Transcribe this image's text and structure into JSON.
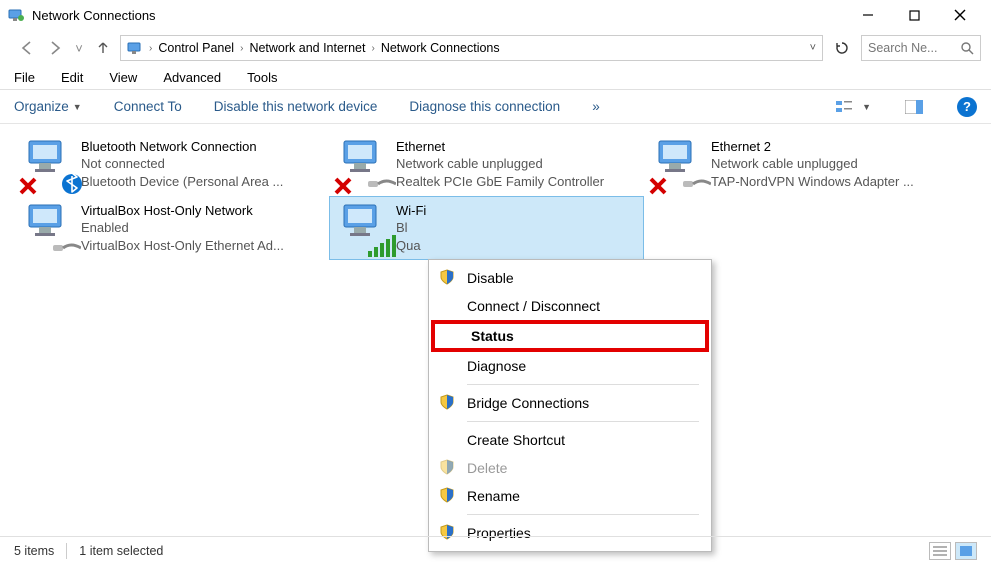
{
  "window": {
    "title": "Network Connections"
  },
  "address": {
    "crumbs": [
      "Control Panel",
      "Network and Internet",
      "Network Connections"
    ]
  },
  "search": {
    "placeholder": "Search Ne..."
  },
  "menubar": [
    "File",
    "Edit",
    "View",
    "Advanced",
    "Tools"
  ],
  "cmdbar": {
    "organize": "Organize",
    "connect": "Connect To",
    "disable": "Disable this network device",
    "diagnose": "Diagnose this connection",
    "more": "»"
  },
  "connections": [
    {
      "name": "Bluetooth Network Connection",
      "status": "Not connected",
      "device": "Bluetooth Device (Personal Area ...",
      "overlay": "bt-x"
    },
    {
      "name": "Ethernet",
      "status": "Network cable unplugged",
      "device": "Realtek PCIe GbE Family Controller",
      "overlay": "cable-x"
    },
    {
      "name": "Ethernet 2",
      "status": "Network cable unplugged",
      "device": "TAP-NordVPN Windows Adapter ...",
      "overlay": "cable-x"
    },
    {
      "name": "VirtualBox Host-Only Network",
      "status": "Enabled",
      "device": "VirtualBox Host-Only Ethernet Ad...",
      "overlay": "cable"
    },
    {
      "name": "Wi-Fi",
      "status": "Bl",
      "device": "Qua",
      "overlay": "signal",
      "selected": true
    }
  ],
  "context_menu": [
    {
      "label": "Disable",
      "icon": "shield"
    },
    {
      "label": "Connect / Disconnect"
    },
    {
      "label": "Status",
      "highlight": true
    },
    {
      "label": "Diagnose"
    },
    {
      "sep": true
    },
    {
      "label": "Bridge Connections",
      "icon": "shield"
    },
    {
      "sep": true
    },
    {
      "label": "Create Shortcut"
    },
    {
      "label": "Delete",
      "icon": "shield",
      "disabled": true
    },
    {
      "label": "Rename",
      "icon": "shield"
    },
    {
      "sep": true
    },
    {
      "label": "Properties",
      "icon": "shield"
    }
  ],
  "statusbar": {
    "count": "5 items",
    "selected": "1 item selected"
  }
}
